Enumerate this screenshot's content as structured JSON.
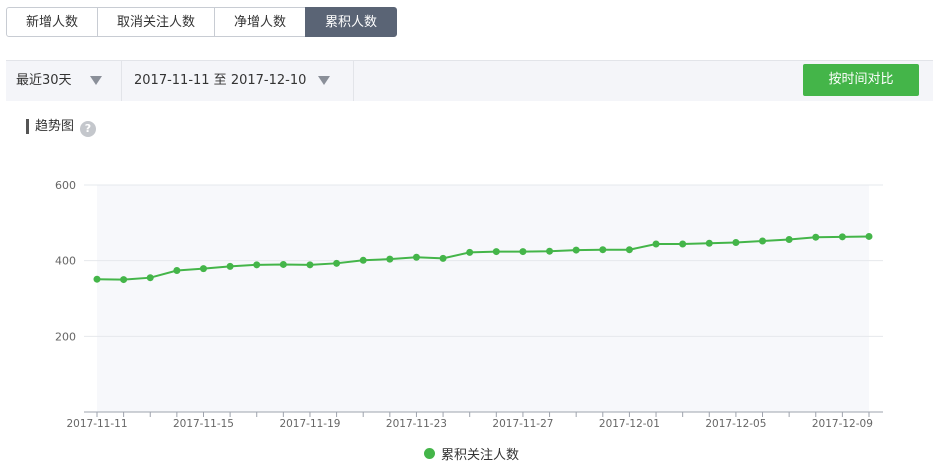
{
  "tabs": [
    {
      "label": "新增人数",
      "active": false
    },
    {
      "label": "取消关注人数",
      "active": false
    },
    {
      "label": "净增人数",
      "active": false
    },
    {
      "label": "累积人数",
      "active": true
    }
  ],
  "filters": {
    "period": "最近30天",
    "date_range": "2017-11-11 至 2017-12-10",
    "compare_button": "按时间对比"
  },
  "section": {
    "title": "趋势图",
    "help_icon": "question-mark-icon"
  },
  "colors": {
    "accent_green": "#44b549",
    "active_tab": "#5a6475"
  },
  "chart_data": {
    "type": "line",
    "title": "",
    "xlabel": "",
    "ylabel": "",
    "ylim": [
      0,
      600
    ],
    "yticks": [
      200,
      400,
      600
    ],
    "grid": true,
    "legend": "bottom-center",
    "x": [
      "2017-11-11",
      "2017-11-12",
      "2017-11-13",
      "2017-11-14",
      "2017-11-15",
      "2017-11-16",
      "2017-11-17",
      "2017-11-18",
      "2017-11-19",
      "2017-11-20",
      "2017-11-21",
      "2017-11-22",
      "2017-11-23",
      "2017-11-24",
      "2017-11-25",
      "2017-11-26",
      "2017-11-27",
      "2017-11-28",
      "2017-11-29",
      "2017-11-30",
      "2017-12-01",
      "2017-12-02",
      "2017-12-03",
      "2017-12-04",
      "2017-12-05",
      "2017-12-06",
      "2017-12-07",
      "2017-12-08",
      "2017-12-09",
      "2017-12-10"
    ],
    "xtick_labels": [
      "2017-11-11",
      "2017-11-15",
      "2017-11-19",
      "2017-11-23",
      "2017-11-27",
      "2017-12-01",
      "2017-12-05",
      "2017-12-09"
    ],
    "series": [
      {
        "name": "累积关注人数",
        "color": "#44b549",
        "values": [
          351,
          350,
          355,
          374,
          379,
          385,
          389,
          390,
          389,
          393,
          401,
          404,
          409,
          406,
          422,
          424,
          424,
          425,
          428,
          429,
          429,
          444,
          444,
          446,
          448,
          452,
          456,
          462,
          463,
          464
        ]
      }
    ]
  }
}
